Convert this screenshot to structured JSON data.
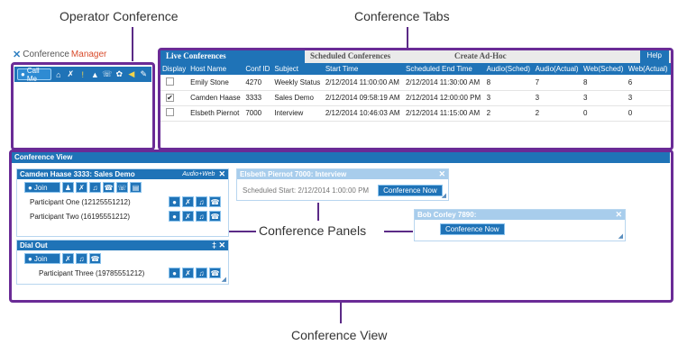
{
  "callouts": {
    "operator_conference": "Operator Conference",
    "conference_tabs": "Conference Tabs",
    "conference_panels": "Conference Panels",
    "conference_view": "Conference View"
  },
  "logo": {
    "prefix": "Conference",
    "suffix": "Manager"
  },
  "operator_toolbar": {
    "call_me": "Call Me"
  },
  "tabs": {
    "live": "Live Conferences",
    "scheduled": "Scheduled Conferences",
    "adhoc": "Create Ad-Hoc",
    "help": "Help"
  },
  "table": {
    "headers": [
      "Display",
      "Host Name",
      "Conf ID",
      "Subject",
      "Start Time",
      "Scheduled End Time",
      "Audio(Sched)",
      "Audio(Actual)",
      "Web(Sched)",
      "Web(Actual)"
    ],
    "rows": [
      {
        "checked": "",
        "host": "Emily Stone",
        "conf_id": "4270",
        "subject": "Weekly Status",
        "start": "2/12/2014 11:00:00 AM",
        "end": "2/12/2014 11:30:00 AM",
        "audio_sched": "8",
        "audio_actual": "7",
        "web_sched": "8",
        "web_actual": "6"
      },
      {
        "checked": "✔",
        "host": "Camden Haase",
        "conf_id": "3333",
        "subject": "Sales Demo",
        "start": "2/12/2014 09:58:19 AM",
        "end": "2/12/2014 12:00:00 PM",
        "audio_sched": "3",
        "audio_actual": "3",
        "web_sched": "3",
        "web_actual": "3"
      },
      {
        "checked": "",
        "host": "Elsbeth Piernot",
        "conf_id": "7000",
        "subject": "Interview",
        "start": "2/12/2014 10:46:03 AM",
        "end": "2/12/2014 11:15:00 AM",
        "audio_sched": "2",
        "audio_actual": "2",
        "web_sched": "0",
        "web_actual": "0"
      }
    ]
  },
  "conference_view": {
    "header": "Conference View",
    "panel_camden": {
      "title": "Camden Haase  3333: Sales Demo",
      "tag": "Audio+Web",
      "join": "Join",
      "participants": [
        "Participant One (12125551212)",
        "Participant Two (16195551212)"
      ]
    },
    "panel_dialout": {
      "title": "Dial Out",
      "join": "Join",
      "participants": [
        "Participant Three (19785551212)"
      ]
    },
    "panel_elsbeth": {
      "title": "Elsbeth Piernot  7000:  Interview",
      "scheduled": "Scheduled Start: 2/12/2014 1:00:00 PM",
      "button": "Conference Now"
    },
    "panel_bob": {
      "title": "Bob Corley  7890:",
      "button": "Conference Now"
    }
  },
  "colors": {
    "accent": "#1f73b7",
    "callout_border": "#6a2b96"
  }
}
